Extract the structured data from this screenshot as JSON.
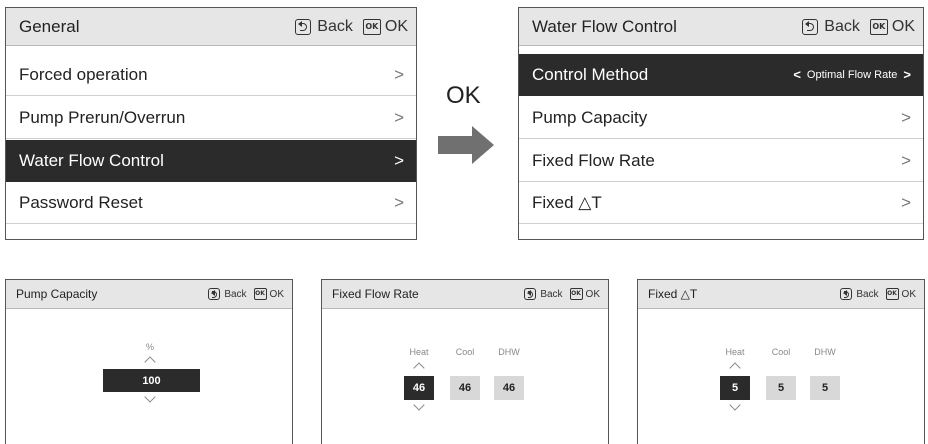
{
  "general": {
    "title": "General",
    "back_label": "Back",
    "ok_label": "OK",
    "ok_icon_text": "OK",
    "items": [
      {
        "label": "Forced operation",
        "chevron": ">"
      },
      {
        "label": "Pump Prerun/Overrun",
        "chevron": ">"
      },
      {
        "label": "Water Flow Control",
        "chevron": ">",
        "selected": true
      },
      {
        "label": "Password Reset",
        "chevron": ">"
      }
    ]
  },
  "transition": {
    "label": "OK"
  },
  "water_flow": {
    "title": "Water Flow Control",
    "back_label": "Back",
    "ok_label": "OK",
    "ok_icon_text": "OK",
    "items": [
      {
        "label": "Control Method",
        "value": "Optimal Flow Rate",
        "left_chevron": "<",
        "chevron": ">",
        "selected": true
      },
      {
        "label": "Pump Capacity",
        "chevron": ">"
      },
      {
        "label": "Fixed Flow Rate",
        "chevron": ">"
      },
      {
        "label": "Fixed △T",
        "chevron": ">"
      }
    ]
  },
  "pump_capacity": {
    "title": "Pump Capacity",
    "back_label": "Back",
    "ok_label": "OK",
    "ok_icon_text": "OK",
    "unit": "%",
    "value": "100"
  },
  "fixed_flow": {
    "title": "Fixed Flow Rate",
    "back_label": "Back",
    "ok_label": "OK",
    "ok_icon_text": "OK",
    "columns": [
      {
        "label": "Heat",
        "value": "46"
      },
      {
        "label": "Cool",
        "value": "46"
      },
      {
        "label": "DHW",
        "value": "46"
      }
    ]
  },
  "fixed_dt": {
    "title": "Fixed △T",
    "back_label": "Back",
    "ok_label": "OK",
    "ok_icon_text": "OK",
    "columns": [
      {
        "label": "Heat",
        "value": "5"
      },
      {
        "label": "Cool",
        "value": "5"
      },
      {
        "label": "DHW",
        "value": "5"
      }
    ]
  },
  "colors": {
    "selected_bg": "#2b2b2b",
    "header_bg": "#e6e6e6",
    "value_box": "#d8d8d8"
  }
}
